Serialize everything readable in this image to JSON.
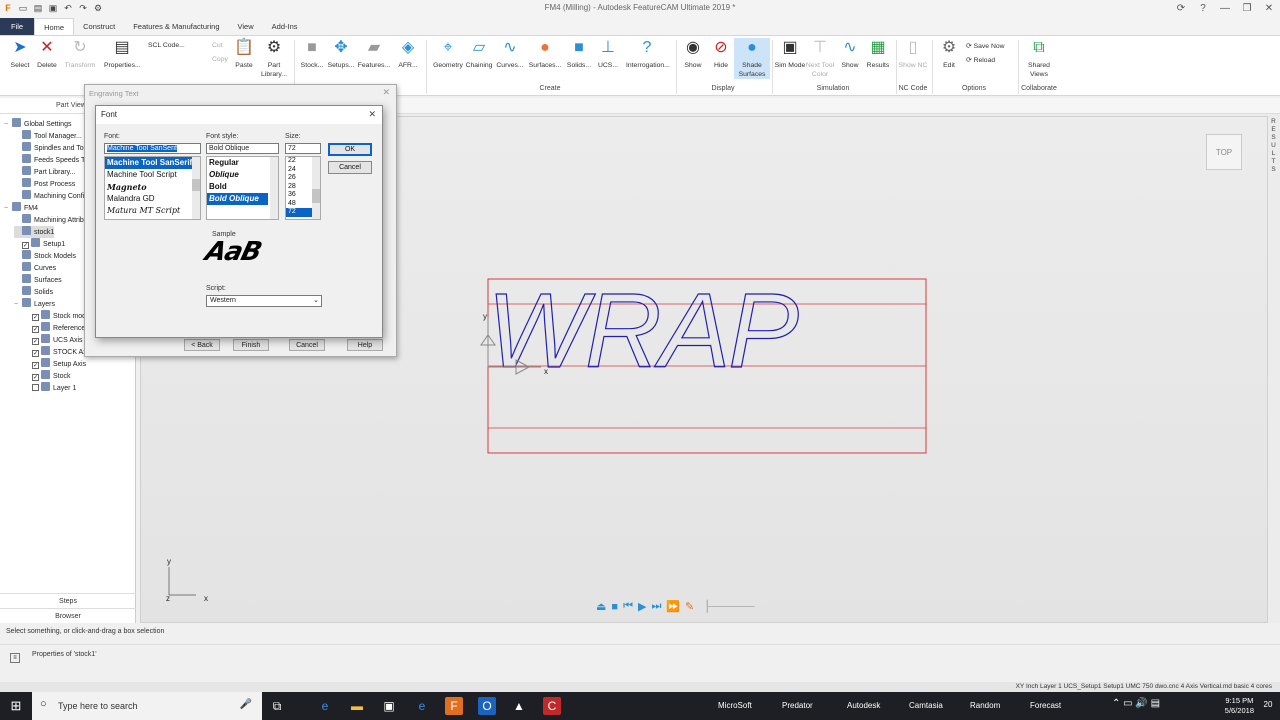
{
  "window": {
    "title": "FM4 (Milling) - Autodesk FeatureCAM Ultimate 2019 *"
  },
  "ribbon": {
    "tabs": [
      "File",
      "Home",
      "Construct",
      "Features & Manufacturing",
      "View",
      "Add-Ins"
    ],
    "active_tab": "Home",
    "buttons": {
      "select": "Select",
      "delete": "Delete",
      "transform": "Transform",
      "properties": "Properties...",
      "scl_code": "SCL Code...",
      "cut": "Cut",
      "copy": "Copy",
      "paste": "Paste",
      "part_library": "Part Library...",
      "stock": "Stock...",
      "setups": "Setups...",
      "features": "Features...",
      "afr": "AFR...",
      "geometry": "Geometry",
      "chaining": "Chaining",
      "curves": "Curves...",
      "surfaces": "Surfaces...",
      "solids": "Solids...",
      "ucs": "UCS...",
      "interrogation": "Interrogation...",
      "show": "Show",
      "hide": "Hide",
      "shade_surfaces": "Shade Surfaces",
      "sim_mode": "Sim Mode",
      "next_tool_color": "Next Tool Color",
      "show_sim": "Show",
      "results": "Results",
      "show_nc": "Show NC",
      "edit": "Edit",
      "save_now": "Save Now",
      "reload": "Reload",
      "shared_views": "Shared Views"
    },
    "groups": [
      "Create",
      "Display",
      "Simulation",
      "NC Code",
      "Options",
      "Collaborate"
    ]
  },
  "left_panel": {
    "header": "Part View",
    "tree": [
      {
        "label": "Global Settings",
        "depth": 0,
        "exp": "−"
      },
      {
        "label": "Tool Manager...",
        "depth": 1
      },
      {
        "label": "Spindles and Tools",
        "depth": 1
      },
      {
        "label": "Feeds  Speeds T",
        "depth": 1
      },
      {
        "label": "Part Library...",
        "depth": 1
      },
      {
        "label": "Post Process",
        "depth": 1
      },
      {
        "label": "Machining Config",
        "depth": 1
      },
      {
        "label": "FM4",
        "depth": 0,
        "exp": "−"
      },
      {
        "label": "Machining Attribu",
        "depth": 1
      },
      {
        "label": "stock1",
        "depth": 1,
        "selected": true
      },
      {
        "label": "Setup1",
        "depth": 1,
        "check": true
      },
      {
        "label": "Stock Models",
        "depth": 1
      },
      {
        "label": "Curves",
        "depth": 1
      },
      {
        "label": "Surfaces",
        "depth": 1
      },
      {
        "label": "Solids",
        "depth": 1
      },
      {
        "label": "Layers",
        "depth": 1,
        "exp": "−"
      },
      {
        "label": "Stock mod",
        "depth": 2,
        "check": true
      },
      {
        "label": "Reference",
        "depth": 2,
        "check": true
      },
      {
        "label": "UCS Axis",
        "depth": 2,
        "check": true
      },
      {
        "label": "STOCK Ax",
        "depth": 2,
        "check": true
      },
      {
        "label": "Setup Axis",
        "depth": 2,
        "check": true
      },
      {
        "label": "Stock",
        "depth": 2,
        "check": true
      },
      {
        "label": "Layer 1",
        "depth": 2,
        "check": false
      }
    ],
    "footer_steps": "Steps",
    "footer_browser": "Browser"
  },
  "viewport": {
    "viewcube_label": "TOP",
    "right_label": "RESULTS",
    "engraved_text": "WRAP",
    "axis_labels": {
      "x": "x",
      "y": "y",
      "z": "z"
    }
  },
  "engraving_dialog": {
    "title": "Engraving Text",
    "buttons": {
      "back": "< Back",
      "finish": "Finish",
      "cancel": "Cancel",
      "help": "Help"
    }
  },
  "font_dialog": {
    "title": "Font",
    "font_label": "Font:",
    "font_value": "Machine Tool SanSerif",
    "fonts": [
      "Machine Tool SanSerif",
      "Machine Tool Script",
      "Magneto",
      "Malandra GD",
      "Matura MT Script"
    ],
    "style_label": "Font style:",
    "style_value": "Bold Oblique",
    "styles": [
      "Regular",
      "Oblique",
      "Bold",
      "Bold Oblique"
    ],
    "size_label": "Size:",
    "size_value": "72",
    "sizes": [
      "22",
      "24",
      "26",
      "28",
      "36",
      "48",
      "72"
    ],
    "ok": "OK",
    "cancel": "Cancel",
    "sample_label": "Sample",
    "sample_text": "AaB",
    "script_label": "Script:",
    "script_value": "Western"
  },
  "status": {
    "hint": "Select something, or click-and-drag a box selection",
    "properties": "Properties of 'stock1'",
    "bottom": "XY  Inch   Layer 1   UCS_Setup1   Setup1   UMC 750 dwo.cnc   4 Axis Vertical.md   basic   4 cores"
  },
  "taskbar": {
    "search_placeholder": "Type here to search",
    "labels": [
      "MicroSoft",
      "Predator",
      "Autodesk",
      "Camtasia",
      "Random",
      "Forecast"
    ],
    "time": "9:15 PM",
    "date": "5/6/2018",
    "notifications": "20"
  }
}
